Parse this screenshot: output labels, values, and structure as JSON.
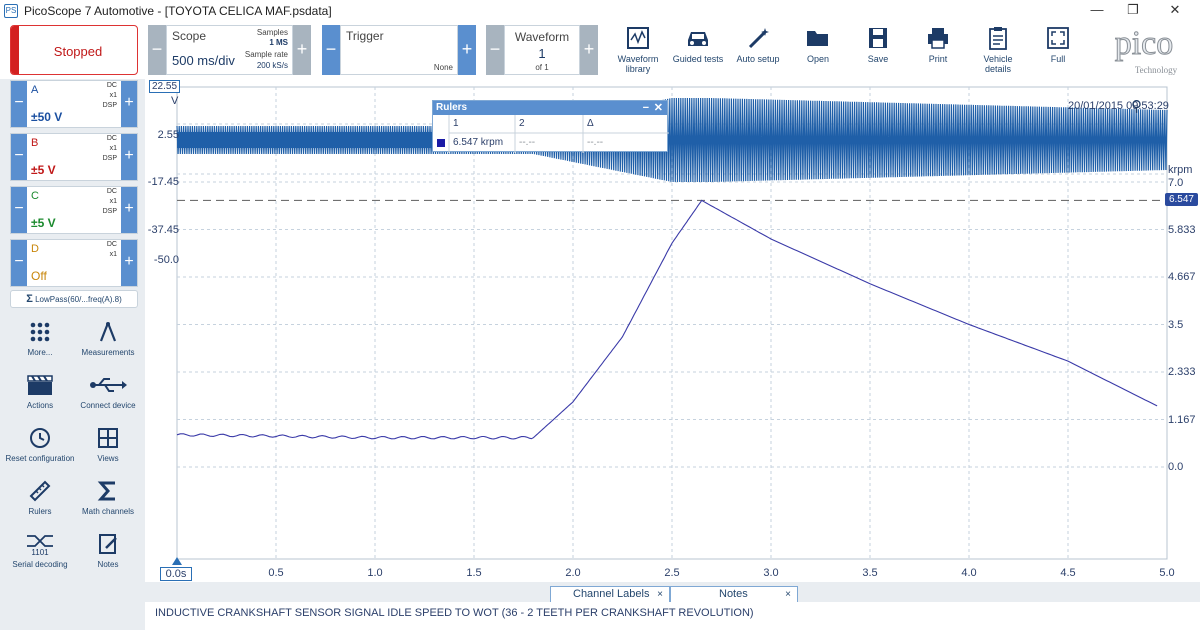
{
  "window": {
    "title": "PicoScope 7 Automotive - [TOYOTA CELICA MAF.psdata]",
    "app_icon_text": "PS",
    "minimize": "—",
    "restore": "❐",
    "close": "✕"
  },
  "toolbar": {
    "run_state": "Stopped",
    "scope_label": "Scope",
    "timebase": "500 ms/div",
    "samples_label": "Samples",
    "samples_value": "1 MS",
    "sample_rate_label": "Sample rate",
    "sample_rate_value": "200 kS/s",
    "trigger_label": "Trigger",
    "trigger_value": "None",
    "waveform_label": "Waveform",
    "waveform_index": "1",
    "waveform_of": "of 1",
    "buttons": {
      "waveform_library": "Waveform library",
      "guided_tests": "Guided tests",
      "auto_setup": "Auto setup",
      "open": "Open",
      "save": "Save",
      "print": "Print",
      "vehicle_details": "Vehicle details",
      "full": "Full"
    },
    "logo_text": "pico",
    "logo_sub": "Technology"
  },
  "channels": [
    {
      "name": "A",
      "range": "±50 V",
      "coupling": "DC",
      "probe": "x1",
      "dsp": "DSP",
      "color": "#1a4fa0"
    },
    {
      "name": "B",
      "range": "±5 V",
      "coupling": "DC",
      "probe": "x1",
      "dsp": "DSP",
      "color": "#c01818"
    },
    {
      "name": "C",
      "range": "±5 V",
      "coupling": "DC",
      "probe": "x1",
      "dsp": "DSP",
      "color": "#1b8a2e"
    },
    {
      "name": "D",
      "range": "Off",
      "coupling": "DC",
      "probe": "x1",
      "dsp": "",
      "color": "#c8860a"
    }
  ],
  "math_channel": "LowPass(60/...freq(A).8)",
  "tools": {
    "more": "More...",
    "measurements": "Measurements",
    "actions": "Actions",
    "connect_device": "Connect device",
    "reset_configuration": "Reset configuration",
    "views": "Views",
    "rulers": "Rulers",
    "math_channels": "Math channels",
    "serial_decoding": "Serial decoding",
    "notes": "Notes"
  },
  "graph": {
    "timestamp": "20/01/2015 09:53:29",
    "left_axis_unit": "V",
    "left_ticks": [
      "22.55",
      "2.55",
      "-17.45",
      "-37.45",
      "-50.0"
    ],
    "right_axis_unit": "krpm",
    "right_ticks": [
      "7.0",
      "5.833",
      "4.667",
      "3.5",
      "2.333",
      "1.167",
      "0.0"
    ],
    "ruler_value": "6.547",
    "x_ticks": [
      "0.0s",
      "0.5",
      "1.0",
      "1.5",
      "2.0",
      "2.5",
      "3.0",
      "3.5",
      "4.0",
      "4.5",
      "5.0"
    ]
  },
  "rulers_panel": {
    "title": "Rulers",
    "col1": "1",
    "col2": "2",
    "col3": "Δ",
    "value1": "6.547 krpm",
    "value2": "--.--",
    "value3": "--.--"
  },
  "tabs": {
    "channel_labels": "Channel Labels",
    "notes": "Notes",
    "close": "×"
  },
  "notes_text": "INDUCTIVE CRANKSHAFT SENSOR SIGNAL IDLE SPEED TO WOT (36 - 2 TEETH PER CRANKSHAFT REVOLUTION)",
  "chart_data": {
    "type": "line",
    "xlabel": "s",
    "xlim": [
      0,
      5
    ],
    "series": [
      {
        "name": "Channel A",
        "unit": "V",
        "ylim": [
          -50,
          22.55
        ],
        "description_points": [
          [
            0,
            2.55
          ],
          [
            5,
            2.55
          ]
        ]
      },
      {
        "name": "LowPass(60/...freq(A).8)",
        "unit": "krpm",
        "ylim": [
          0,
          7
        ],
        "x": [
          0.0,
          0.5,
          1.0,
          1.5,
          1.8,
          2.0,
          2.25,
          2.5,
          2.65,
          3.0,
          3.5,
          4.0,
          4.5,
          4.95
        ],
        "values": [
          0.79,
          0.76,
          0.72,
          0.72,
          0.72,
          1.6,
          3.2,
          5.5,
          6.547,
          5.6,
          4.5,
          3.5,
          2.6,
          1.5
        ]
      }
    ],
    "ruler_krpm": 6.547
  },
  "colors": {
    "accent": "#5a8fcf",
    "trace_a": "#1f5fa8",
    "trace_rpm": "#3a3aa8",
    "stopped": "#d32020"
  }
}
